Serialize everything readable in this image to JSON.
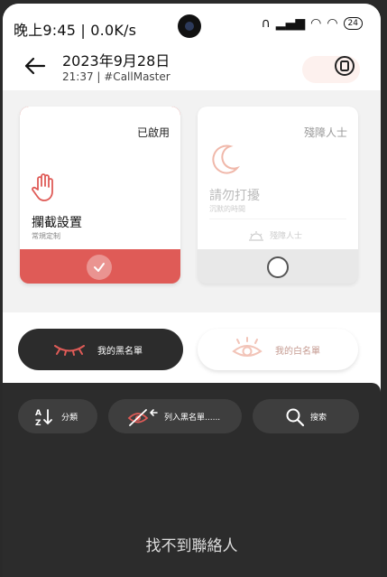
{
  "status_bar": {
    "time": "晚上9:45 | 0.0K/s",
    "battery": "24"
  },
  "header": {
    "title": "2023年9月28日",
    "subtitle": "21:37 | #CallMaster"
  },
  "cards": [
    {
      "tag": "已啟用",
      "title": "攔截設置",
      "desc": "常規定制",
      "selected": true
    },
    {
      "tag": "殘障人士",
      "title": "請勿打擾",
      "desc": "沉默的時間",
      "sub": "殘障人士",
      "selected": false
    }
  ],
  "tabs": {
    "blacklist": "我的黑名單",
    "whitelist": "我的白名單"
  },
  "tools": {
    "sort": "分類",
    "add_blacklist": "列入黑名單......",
    "search": "搜索"
  },
  "empty_message": "找不到聯絡人",
  "colors": {
    "accent_red": "#df5b57",
    "dark_panel": "#2c2c2c",
    "pale_pink": "#f2c4b8"
  }
}
